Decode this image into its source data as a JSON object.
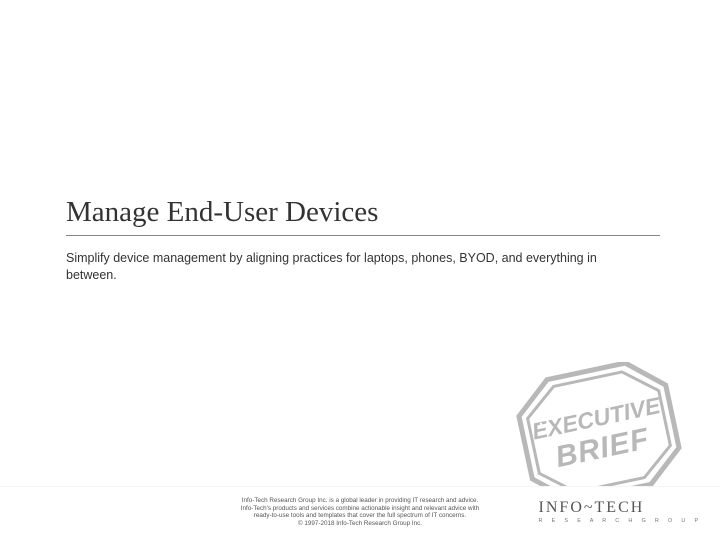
{
  "title": "Manage End-User Devices",
  "subtitle": "Simplify device management by aligning practices for laptops, phones, BYOD, and everything in between.",
  "footer": {
    "line1": "Info-Tech Research Group Inc. is a global leader in providing IT research and advice.",
    "line2": "Info-Tech's products and services combine actionable insight and relevant advice with",
    "line3": "ready-to-use tools and templates that cover the full spectrum of IT concerns.",
    "line4": "© 1997-2018 Info-Tech Research Group Inc."
  },
  "logo": {
    "main": "INFO~TECH",
    "sub": "R E S E A R C H    G R O U P"
  },
  "stamp": {
    "line1": "EXECUTIVE",
    "line2": "BRIEF"
  },
  "colors": {
    "stamp": "#b8b8b8",
    "text": "#333333"
  }
}
